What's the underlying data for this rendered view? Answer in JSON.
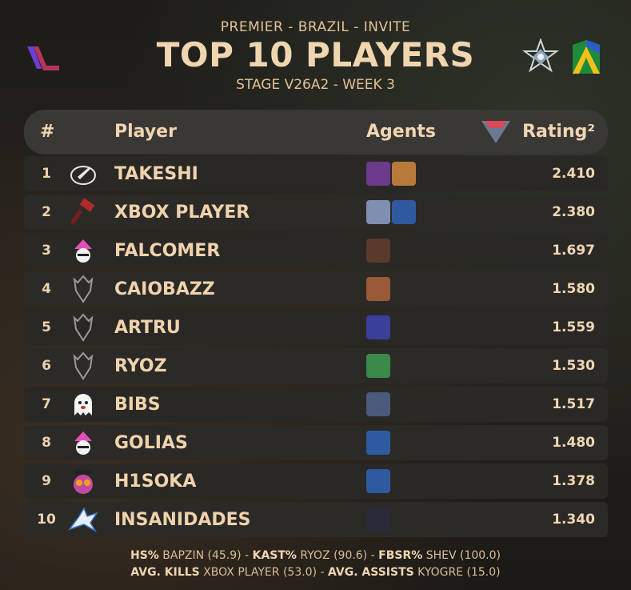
{
  "header": {
    "subtitle": "PREMIER - BRAZIL - INVITE",
    "title": "TOP 10 PLAYERS",
    "stage": "STAGE V26A2 - WEEK 3"
  },
  "columns": {
    "rank": "#",
    "player": "Player",
    "agents": "Agents",
    "rating": "Rating²"
  },
  "rows": [
    {
      "rank": "1",
      "player": "TAKESHI",
      "rating": "2.410",
      "team_icon": "rocket-team-icon",
      "agents": [
        "#6a3b8a",
        "#b87a3a"
      ]
    },
    {
      "rank": "2",
      "player": "XBOX PLAYER",
      "rating": "2.380",
      "team_icon": "hammer-team-icon",
      "agents": [
        "#7e8fb0",
        "#2f5aa0"
      ]
    },
    {
      "rank": "3",
      "player": "FALCOMER",
      "rating": "1.697",
      "team_icon": "pink-hat-team-icon",
      "agents": [
        "#5a3a2a"
      ]
    },
    {
      "rank": "4",
      "player": "CAIOBAZZ",
      "rating": "1.580",
      "team_icon": "dragon-team-icon",
      "agents": [
        "#9a5a3a"
      ]
    },
    {
      "rank": "5",
      "player": "ARTRU",
      "rating": "1.559",
      "team_icon": "dragon-team-icon",
      "agents": [
        "#3a3f9a"
      ]
    },
    {
      "rank": "6",
      "player": "RYOZ",
      "rating": "1.530",
      "team_icon": "dragon-team-icon",
      "agents": [
        "#3a8a4a"
      ]
    },
    {
      "rank": "7",
      "player": "BIBS",
      "rating": "1.517",
      "team_icon": "ghost-team-icon",
      "agents": [
        "#4a5a7a"
      ]
    },
    {
      "rank": "8",
      "player": "GOLIAS",
      "rating": "1.480",
      "team_icon": "pink-hat-team-icon",
      "agents": [
        "#2f5aa0"
      ]
    },
    {
      "rank": "9",
      "player": "H1SOKA",
      "rating": "1.378",
      "team_icon": "owl-team-icon",
      "agents": [
        "#2f5aa0"
      ]
    },
    {
      "rank": "10",
      "player": "INSANIDADES",
      "rating": "1.340",
      "team_icon": "wolf-team-icon",
      "agents": [
        "#2a2a3a"
      ]
    }
  ],
  "footer": {
    "line1": [
      {
        "label": "HS%",
        "value": "BAPZIN (45.9)"
      },
      {
        "label": "KAST%",
        "value": "RYOZ (90.6)"
      },
      {
        "label": "FBSR%",
        "value": "SHEV (100.0)"
      }
    ],
    "line2": [
      {
        "label": "AVG. KILLS",
        "value": "XBOX PLAYER (53.0)"
      },
      {
        "label": "AVG. ASSISTS",
        "value": "KYOGRE (15.0)"
      }
    ]
  },
  "colors": {
    "accent": "#efd5b0",
    "row_bg": "#2a2825",
    "header_bg": "#3a3835",
    "rating_icon": "#d94a5a"
  }
}
